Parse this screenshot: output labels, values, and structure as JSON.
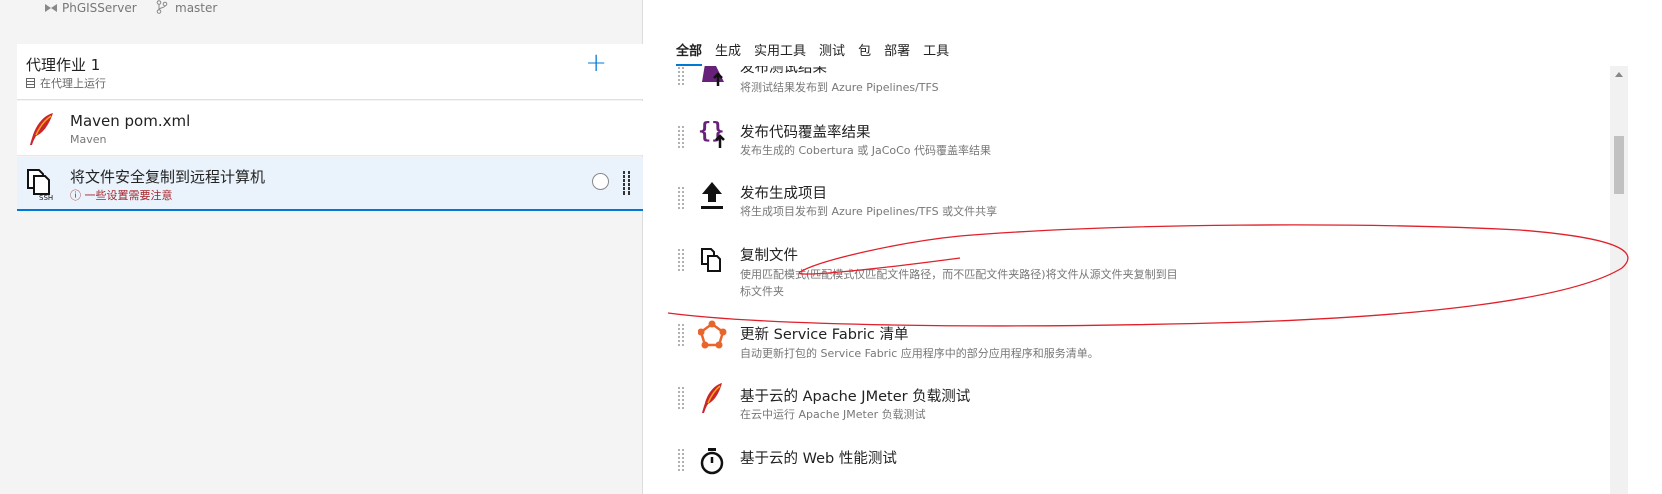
{
  "repo_bar": {
    "repo_name": "PhGISServer",
    "branch_name": "master"
  },
  "left": {
    "agent_job": {
      "title": "代理作业 1",
      "subtitle": "在代理上运行",
      "add_symbol": "+"
    },
    "tasks": [
      {
        "title": "Maven pom.xml",
        "subtitle": "Maven"
      },
      {
        "title": "将文件安全复制到远程计算机",
        "warning": "ⓘ 一些设置需要注意"
      }
    ]
  },
  "right": {
    "tabs": [
      "全部",
      "生成",
      "实用工具",
      "测试",
      "包",
      "部署",
      "工具"
    ],
    "active_tab": "全部",
    "entries": [
      {
        "icon": "publish-test-results-icon",
        "title": "发布测试结果",
        "desc": "将测试结果发布到 Azure Pipelines/TFS"
      },
      {
        "icon": "publish-code-coverage-icon",
        "title": "发布代码覆盖率结果",
        "desc": "发布生成的 Cobertura 或 JaCoCo 代码覆盖率结果"
      },
      {
        "icon": "publish-build-artifacts-icon",
        "title": "发布生成项目",
        "desc": "将生成项目发布到 Azure Pipelines/TFS 或文件共享"
      },
      {
        "icon": "copy-files-icon",
        "title": "复制文件",
        "desc": "使用匹配模式(匹配模式仅匹配文件路径，而不匹配文件夹路径)将文件从源文件夹复制到目",
        "desc2": "标文件夹"
      },
      {
        "icon": "service-fabric-icon",
        "title": "更新 Service Fabric 清单",
        "desc": "自动更新打包的 Service Fabric 应用程序中的部分应用程序和服务清单。"
      },
      {
        "icon": "jmeter-feather-icon",
        "title": "基于云的 Apache JMeter 负载测试",
        "desc": "在云中运行 Apache JMeter 负载测试"
      },
      {
        "icon": "web-performance-timer-icon",
        "title": "基于云的 Web 性能测试",
        "desc": ""
      }
    ]
  },
  "colors": {
    "accent": "#0078d4",
    "warning": "#a4262c",
    "annotation": "#e0202a",
    "purple": "#68217a",
    "orange": "#e8652b"
  }
}
